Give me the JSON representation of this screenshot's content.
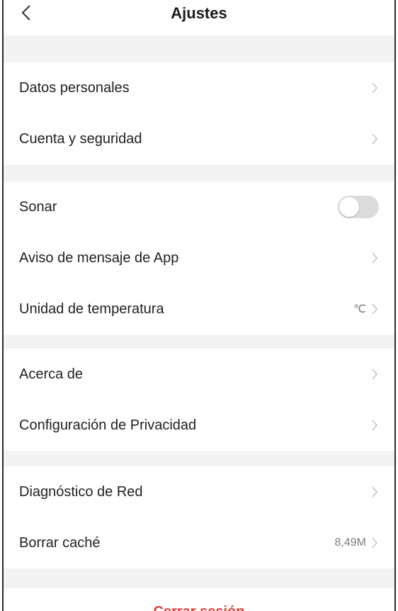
{
  "header": {
    "title": "Ajustes"
  },
  "sections": [
    {
      "items": [
        {
          "label": "Datos personales"
        },
        {
          "label": "Cuenta y seguridad"
        }
      ]
    },
    {
      "items": [
        {
          "label": "Sonar",
          "toggle": false
        },
        {
          "label": "Aviso de mensaje de App"
        },
        {
          "label": "Unidad de temperatura",
          "value": "℃"
        }
      ]
    },
    {
      "items": [
        {
          "label": "Acerca de"
        },
        {
          "label": "Configuración de Privacidad"
        }
      ]
    },
    {
      "items": [
        {
          "label": "Diagnóstico de Red"
        },
        {
          "label": "Borrar caché",
          "value": "8,49M"
        }
      ]
    }
  ],
  "logout": {
    "label": "Cerrar sesión"
  },
  "colors": {
    "logout": "#e0403a",
    "section_gap": "#f3f3f3",
    "toggle_off": "#dcdcdc",
    "chevron": "#c4c4c4"
  }
}
